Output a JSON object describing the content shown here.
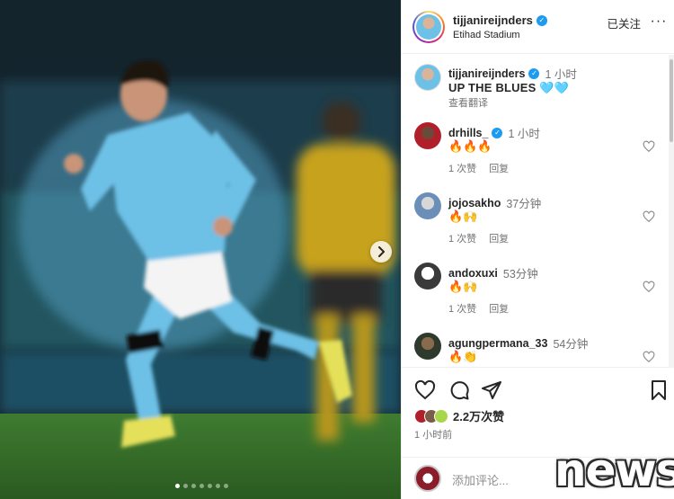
{
  "post": {
    "author": "tijjanireijnders",
    "location": "Etihad Stadium",
    "follow_status": "已关注",
    "more_glyph": "···"
  },
  "media": {
    "next_glyph": "›",
    "dots_total": 7,
    "active_dot": 0
  },
  "caption": {
    "username": "tijjanireijnders",
    "time": "1 小时",
    "text": "UP THE BLUES 🩵🩵",
    "translate": "查看翻译"
  },
  "comments": [
    {
      "username": "drhills_",
      "verified": true,
      "time": "1 小时",
      "text": "🔥🔥🔥",
      "likes": "1 次赞",
      "reply": "回复"
    },
    {
      "username": "jojosakho",
      "verified": false,
      "time": "37分钟",
      "text": "🔥🙌",
      "likes": "1 次赞",
      "reply": "回复"
    },
    {
      "username": "andoxuxi",
      "verified": false,
      "time": "53分钟",
      "text": "🔥🙌",
      "likes": "1 次赞",
      "reply": "回复"
    },
    {
      "username": "agungpermana_33",
      "verified": false,
      "time": "54分钟",
      "text": "🔥👏",
      "likes": "",
      "reply": ""
    }
  ],
  "actions": {
    "likes_text": "2.2万次赞",
    "posted_time": "1 小时前",
    "add_comment_placeholder": "添加评论..."
  },
  "icons": {
    "verified": "verified-badge-icon",
    "heart": "heart-icon",
    "comment": "comment-icon",
    "share": "share-icon",
    "save": "bookmark-icon"
  },
  "colors": {
    "verified": "#1d9bf0",
    "text": "#262626",
    "muted": "#737373",
    "jersey": "#6dc0e6"
  },
  "watermark": "news"
}
